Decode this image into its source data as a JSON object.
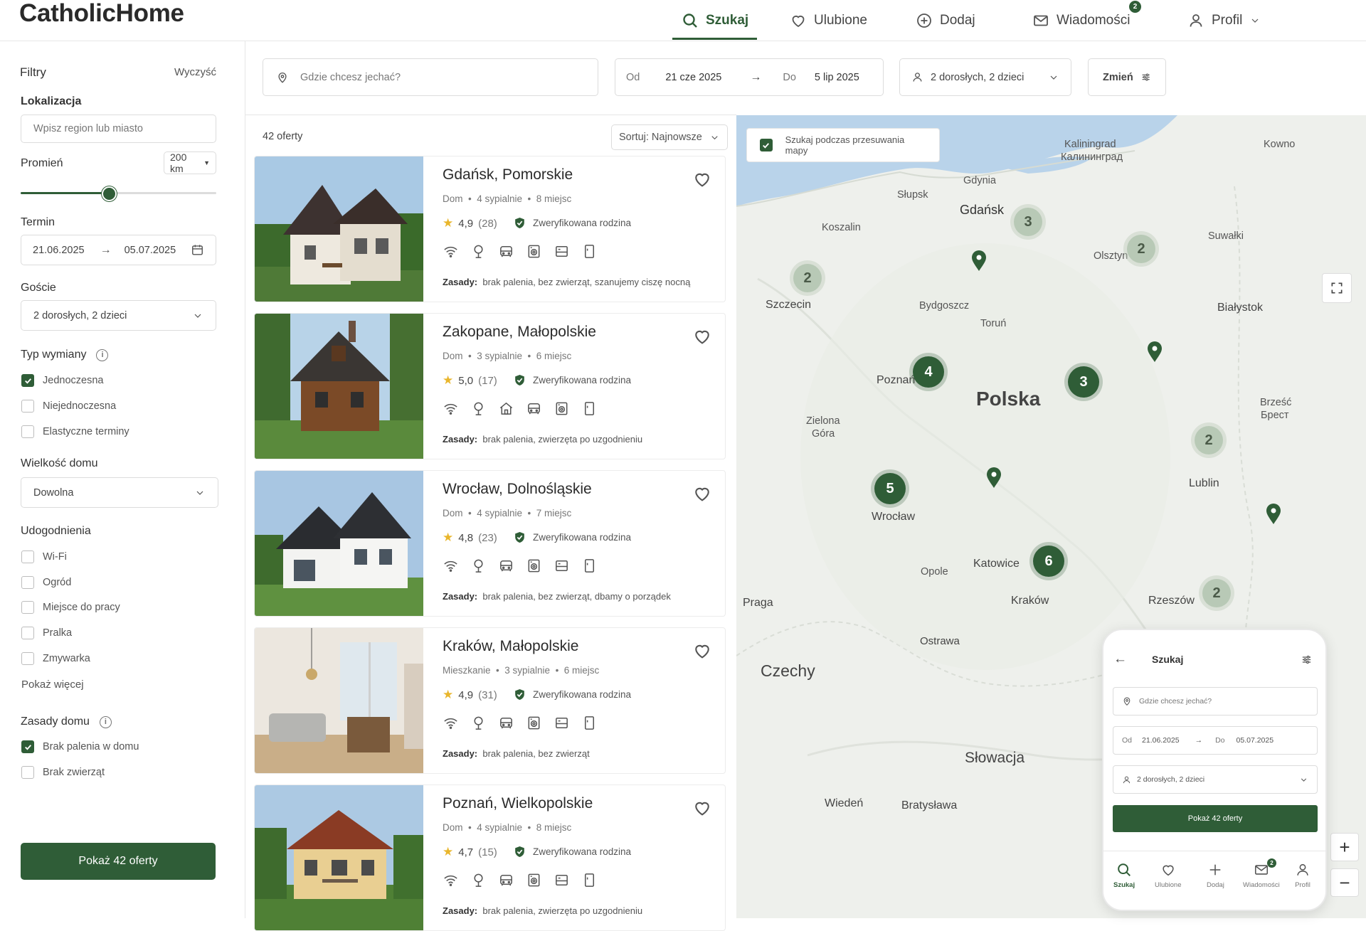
{
  "app": {
    "logo": "CatholicHome"
  },
  "nav": {
    "search": "Szukaj",
    "favorites": "Ulubione",
    "add": "Dodaj",
    "messages": "Wiadomości",
    "messages_badge": "2",
    "profile": "Profil"
  },
  "sidebar": {
    "title": "Filtry",
    "clear": "Wyczyść",
    "location_label": "Lokalizacja",
    "location_placeholder": "Wpisz region lub miasto",
    "radius_label": "Promień",
    "radius_value": "200 km",
    "radius_fraction": 0.45,
    "term_label": "Termin",
    "date_from": "21.06.2025",
    "date_to": "05.07.2025",
    "guests_label": "Goście",
    "guests_value": "2 dorosłych, 2 dzieci",
    "exchange_label": "Typ wymiany",
    "exchange": [
      {
        "label": "Jednoczesna",
        "checked": true
      },
      {
        "label": "Niejednoczesna",
        "checked": false
      },
      {
        "label": "Elastyczne terminy",
        "checked": false
      }
    ],
    "size_label": "Wielkość domu",
    "size_value": "Dowolna",
    "amenities_label": "Udogodnienia",
    "amenities": [
      {
        "label": "Wi-Fi",
        "checked": false
      },
      {
        "label": "Ogród",
        "checked": false
      },
      {
        "label": "Miejsce do pracy",
        "checked": false
      },
      {
        "label": "Pralka",
        "checked": false
      },
      {
        "label": "Zmywarka",
        "checked": false
      }
    ],
    "show_more": "Pokaż więcej",
    "rules_label": "Zasady domu",
    "rules": [
      {
        "label": "Brak palenia w domu",
        "checked": true
      },
      {
        "label": "Brak zwierząt",
        "checked": false
      }
    ],
    "show_button": "Pokaż 42 oferty"
  },
  "search": {
    "where_placeholder": "Gdzie chcesz jechać?",
    "from_label": "Od",
    "from_value": "21 cze 2025",
    "to_label": "Do",
    "to_value": "5 lip 2025",
    "guests": "2 dorosłych, 2 dzieci",
    "change": "Zmień"
  },
  "results": {
    "count": "42 oferty",
    "sort": "Sortuj: Najnowsze"
  },
  "listings": [
    {
      "city": "Gdańsk, Pomorskie",
      "type": "Dom",
      "bedrooms": "4 sypialnie",
      "places": "8 miejsc",
      "rating": "4,9",
      "reviews": "(28)",
      "verified": "Zweryfikowana rodzina",
      "amenities": [
        "wifi-icon",
        "garden-icon",
        "car-icon",
        "washer-icon",
        "workspace-icon",
        "fridge-icon"
      ],
      "rules_label": "Zasady:",
      "rules": "brak palenia, bez zwierząt, szanujemy ciszę nocną"
    },
    {
      "city": "Zakopane, Małopolskie",
      "type": "Dom",
      "bedrooms": "3 sypialnie",
      "places": "6 miejsc",
      "rating": "5,0",
      "reviews": "(17)",
      "verified": "Zweryfikowana rodzina",
      "amenities": [
        "wifi-icon",
        "garden-icon",
        "home-icon",
        "car-icon",
        "washer-icon",
        "fridge-icon"
      ],
      "rules_label": "Zasady:",
      "rules": "brak palenia, zwierzęta po uzgodnieniu"
    },
    {
      "city": "Wrocław, Dolnośląskie",
      "type": "Dom",
      "bedrooms": "4 sypialnie",
      "places": "7 miejsc",
      "rating": "4,8",
      "reviews": "(23)",
      "verified": "Zweryfikowana rodzina",
      "amenities": [
        "wifi-icon",
        "garden-icon",
        "car-icon",
        "washer-icon",
        "workspace-icon",
        "fridge-icon"
      ],
      "rules_label": "Zasady:",
      "rules": "brak palenia, bez zwierząt, dbamy o porządek"
    },
    {
      "city": "Kraków, Małopolskie",
      "type": "Mieszkanie",
      "bedrooms": "3 sypialnie",
      "places": "6 miejsc",
      "rating": "4,9",
      "reviews": "(31)",
      "verified": "Zweryfikowana rodzina",
      "amenities": [
        "wifi-icon",
        "garden-icon",
        "car-icon",
        "washer-icon",
        "workspace-icon",
        "fridge-icon"
      ],
      "rules_label": "Zasady:",
      "rules": "brak palenia, bez zwierząt"
    },
    {
      "city": "Poznań, Wielkopolskie",
      "type": "Dom",
      "bedrooms": "4 sypialnie",
      "places": "8 miejsc",
      "rating": "4,7",
      "reviews": "(15)",
      "verified": "Zweryfikowana rodzina",
      "amenities": [
        "wifi-icon",
        "garden-icon",
        "car-icon",
        "washer-icon",
        "workspace-icon",
        "fridge-icon"
      ],
      "rules_label": "Zasady:",
      "rules": "brak palenia, zwierzęta po uzgodnieniu"
    }
  ],
  "map": {
    "search_on_move": "Szukaj podczas przesuwania mapy",
    "country": "Polska",
    "cities": [
      "Gdynia",
      "Gdańsk",
      "Słupsk",
      "Koszalin",
      "Kaliningrad",
      "Калининград",
      "Kowno",
      "Olsztyn",
      "Suwałki",
      "Szczecin",
      "Bydgoszcz",
      "Toruń",
      "Białystok",
      "Poznań",
      "Zielona",
      "Góra",
      "Brześć",
      "Брест",
      "Lublin",
      "Wrocław",
      "Opole",
      "Katowice",
      "Kraków",
      "Rzeszów",
      "Praga",
      "Ostrawa",
      "Czechy",
      "Słowacja",
      "Wiedeń",
      "Bratysława"
    ],
    "clusters": [
      "3",
      "2",
      "2",
      "4",
      "3",
      "2",
      "5",
      "6",
      "2"
    ],
    "zoom_in": "+",
    "zoom_out": "−"
  },
  "phone": {
    "title": "Szukaj",
    "where_placeholder": "Gdzie chcesz jechać?",
    "from_label": "Od",
    "from_value": "21.06.2025",
    "to_label": "Do",
    "to_value": "05.07.2025",
    "guests": "2 dorosłych, 2 dzieci",
    "button": "Pokaż 42 oferty",
    "nav": [
      "Szukaj",
      "Ulubione",
      "Dodaj",
      "Wiadomości",
      "Profil"
    ],
    "badge": "2"
  }
}
